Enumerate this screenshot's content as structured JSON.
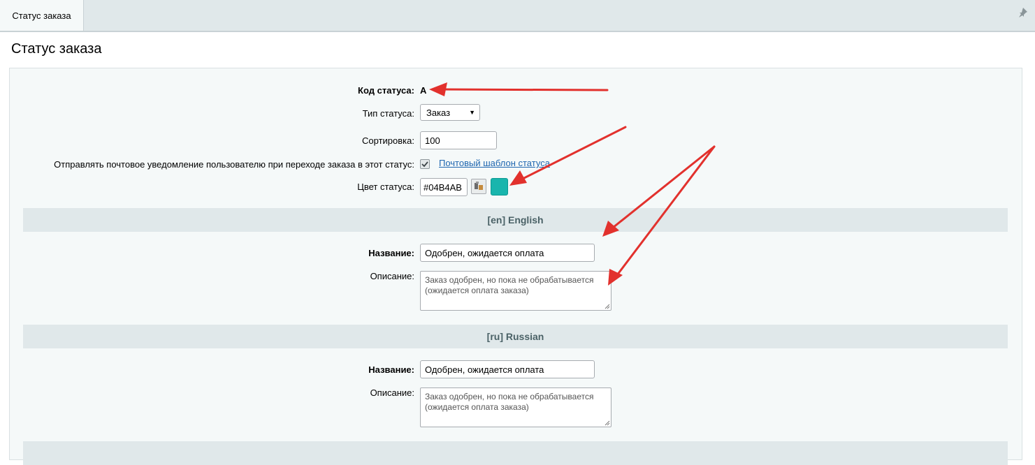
{
  "tabbar": {
    "tab_label": "Статус заказа"
  },
  "page": {
    "title": "Статус заказа"
  },
  "form": {
    "code_label": "Код статуса:",
    "code_value": "A",
    "type_label": "Тип статуса:",
    "type_selected": "Заказ",
    "sort_label": "Сортировка:",
    "sort_value": "100",
    "notify_label": "Отправлять почтовое уведомление пользователю при переходе заказа в этот статус:",
    "notify_checked": true,
    "notify_link": "Почтовый шаблон статуса",
    "color_label": "Цвет статуса:",
    "color_value": "#04B4AB",
    "color_swatch": "#19b5ad"
  },
  "sections": [
    {
      "header": "[en] English",
      "name_label": "Название:",
      "name_value": "Одобрен, ожидается оплата",
      "desc_label": "Описание:",
      "desc_line1": "Заказ одобрен, но пока не обрабатывается",
      "desc_line2": "(ожидается оплата заказа)"
    },
    {
      "header": "[ru] Russian",
      "name_label": "Название:",
      "name_value": "Одобрен, ожидается оплата",
      "desc_label": "Описание:",
      "desc_line1": "Заказ одобрен, но пока не обрабатывается",
      "desc_line2": "(ожидается оплата заказа)"
    }
  ],
  "colors": {
    "annotation_arrow": "#e2312d",
    "link": "#2067b0",
    "section_header_bg": "#e0e8ea"
  }
}
